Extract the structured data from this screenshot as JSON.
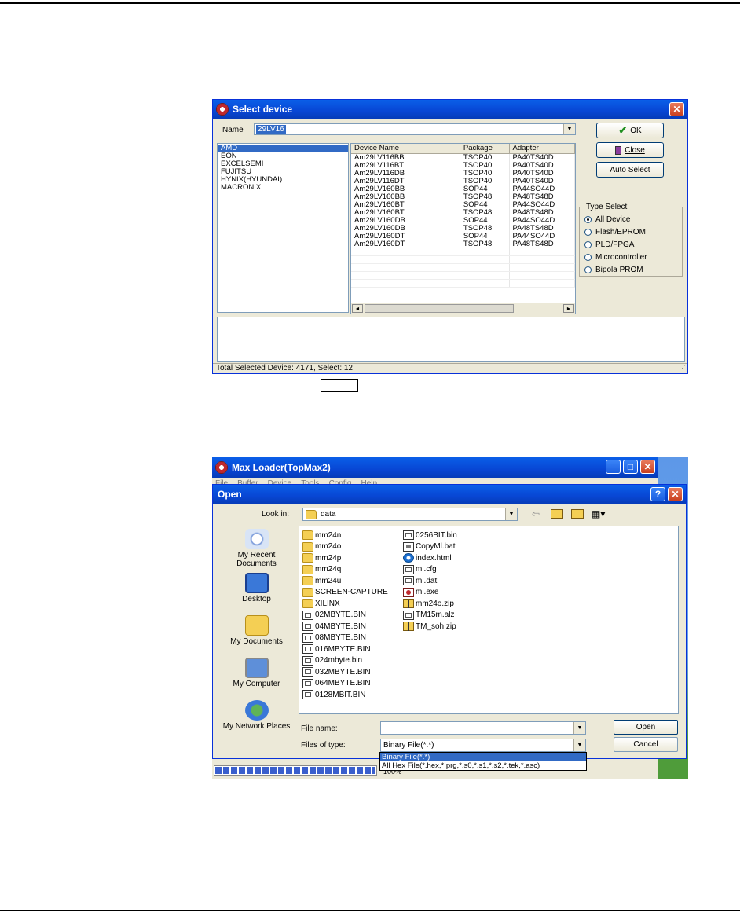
{
  "select_device": {
    "title": "Select device",
    "name_label": "Name",
    "name_value": "29LV16",
    "manufacturers": [
      "AMD",
      "EON",
      "EXCELSEMI",
      "FUJITSU",
      "HYNIX(HYUNDAI)",
      "MACRONIX"
    ],
    "selected_manufacturer": "AMD",
    "columns": [
      "Device Name",
      "Package",
      "Adapter"
    ],
    "devices": [
      [
        "Am29LV116BB",
        "TSOP40",
        "PA40TS40D"
      ],
      [
        "Am29LV116BT",
        "TSOP40",
        "PA40TS40D"
      ],
      [
        "Am29LV116DB",
        "TSOP40",
        "PA40TS40D"
      ],
      [
        "Am29LV116DT",
        "TSOP40",
        "PA40TS40D"
      ],
      [
        "Am29LV160BB",
        "SOP44",
        "PA44SO44D"
      ],
      [
        "Am29LV160BB",
        "TSOP48",
        "PA48TS48D"
      ],
      [
        "Am29LV160BT",
        "SOP44",
        "PA44SO44D"
      ],
      [
        "Am29LV160BT",
        "TSOP48",
        "PA48TS48D"
      ],
      [
        "Am29LV160DB",
        "SOP44",
        "PA44SO44D"
      ],
      [
        "Am29LV160DB",
        "TSOP48",
        "PA48TS48D"
      ],
      [
        "Am29LV160DT",
        "SOP44",
        "PA44SO44D"
      ],
      [
        "Am29LV160DT",
        "TSOP48",
        "PA48TS48D"
      ]
    ],
    "buttons": {
      "ok": "OK",
      "close": "Close",
      "auto_select": "Auto Select"
    },
    "type_select": {
      "label": "Type Select",
      "options": [
        "All Device",
        "Flash/EPROM",
        "PLD/FPGA",
        "Microcontroller",
        "Bipola PROM"
      ],
      "selected": "All Device"
    },
    "status": "Total Selected Device: 4171, Select: 12"
  },
  "maxloader": {
    "title": "Max Loader(TopMax2)",
    "menu": [
      "File",
      "Buffer",
      "Device",
      "Tools",
      "Config",
      "Help"
    ],
    "progress_text": "100%"
  },
  "open_dialog": {
    "title": "Open",
    "look_in_label": "Look in:",
    "look_in_value": "data",
    "places": [
      "My Recent Documents",
      "Desktop",
      "My Documents",
      "My Computer",
      "My Network Places"
    ],
    "files_col1": [
      {
        "name": "mm24n",
        "icon": "folder-icon"
      },
      {
        "name": "mm24o",
        "icon": "folder-icon"
      },
      {
        "name": "mm24p",
        "icon": "folder-icon"
      },
      {
        "name": "mm24q",
        "icon": "folder-icon"
      },
      {
        "name": "mm24u",
        "icon": "folder-icon"
      },
      {
        "name": "SCREEN-CAPTURE",
        "icon": "folder-icon"
      },
      {
        "name": "XILINX",
        "icon": "folder-icon"
      },
      {
        "name": "02MBYTE.BIN",
        "icon": "bin-file-icon"
      },
      {
        "name": "04MBYTE.BIN",
        "icon": "bin-file-icon"
      },
      {
        "name": "08MBYTE.BIN",
        "icon": "bin-file-icon"
      },
      {
        "name": "016MBYTE.BIN",
        "icon": "bin-file-icon"
      },
      {
        "name": "024mbyte.bin",
        "icon": "bin-file-icon"
      },
      {
        "name": "032MBYTE.BIN",
        "icon": "bin-file-icon"
      },
      {
        "name": "064MBYTE.BIN",
        "icon": "bin-file-icon"
      },
      {
        "name": "0128MBIT.BIN",
        "icon": "bin-file-icon"
      }
    ],
    "files_col2": [
      {
        "name": "0256BIT.bin",
        "icon": "bin-file-icon"
      },
      {
        "name": "CopyMl.bat",
        "icon": "batch-file-icon"
      },
      {
        "name": "index.html",
        "icon": "html-file-icon"
      },
      {
        "name": "ml.cfg",
        "icon": "bin-file-icon"
      },
      {
        "name": "ml.dat",
        "icon": "bin-file-icon"
      },
      {
        "name": "ml.exe",
        "icon": "exe-file-icon"
      },
      {
        "name": "mm24o.zip",
        "icon": "zip-file-icon"
      },
      {
        "name": "TM15m.alz",
        "icon": "bin-file-icon"
      },
      {
        "name": "TM_soh.zip",
        "icon": "zip-file-icon"
      }
    ],
    "file_name_label": "File name:",
    "file_name_value": "",
    "files_of_type_label": "Files of type:",
    "files_of_type_value": "Binary File(*.*)",
    "type_options": [
      "Binary File(*.*)",
      "All Hex File(*.hex,*.prg,*.s0,*.s1,*.s2,*.tek,*.asc)"
    ],
    "buttons": {
      "open": "Open",
      "cancel": "Cancel"
    }
  }
}
